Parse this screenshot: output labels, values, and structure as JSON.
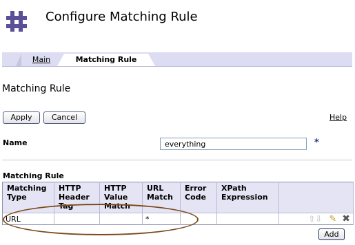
{
  "header": {
    "title": "Configure Matching Rule"
  },
  "tabs": [
    {
      "label": "Main",
      "active": false
    },
    {
      "label": "Matching Rule",
      "active": true
    }
  ],
  "section_heading": "Matching Rule",
  "toolbar": {
    "apply_label": "Apply",
    "cancel_label": "Cancel",
    "help_label": "Help"
  },
  "form": {
    "name_label": "Name",
    "name_value": "everything",
    "required_marker": "*"
  },
  "table": {
    "label": "Matching Rule",
    "columns": [
      "Matching Type",
      "HTTP Header Tag",
      "HTTP Value Match",
      "URL Match",
      "Error Code",
      "XPath Expression"
    ],
    "rows": [
      {
        "matching_type": "URL",
        "http_header_tag": "",
        "http_value_match": "",
        "url_match": "*",
        "error_code": "",
        "xpath_expression": ""
      }
    ],
    "add_label": "Add"
  },
  "icons": {
    "logo": "grid-logo-icon",
    "move_up": "arrow-up-icon",
    "move_down": "arrow-down-icon",
    "edit": "pencil-icon",
    "delete": "delete-x-icon"
  },
  "colors": {
    "tab_bar": "#dcdcf2",
    "table_header": "#e4e4f4",
    "required_marker": "#1f3a93",
    "annotation_oval": "#7b4a1a",
    "logo": "#5b4f96"
  }
}
